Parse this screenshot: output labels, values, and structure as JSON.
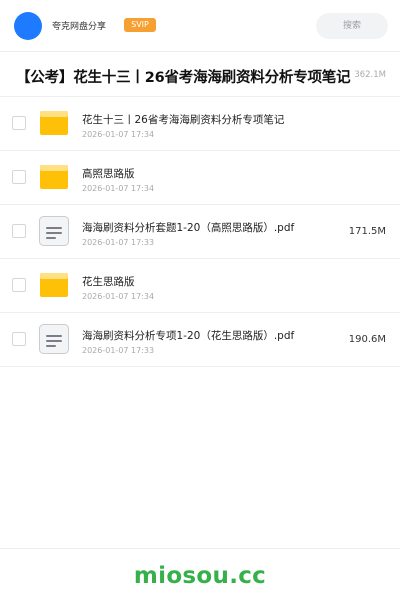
{
  "header": {
    "share_name": "夸克网盘分享",
    "badge": "SVIP",
    "search_label": "搜索"
  },
  "folder": {
    "title": "【公考】花生十三丨26省考海海刷资料分析专项笔记",
    "size": "362.1M"
  },
  "files": [
    {
      "type": "folder",
      "icon": "folder-icon",
      "name": "花生十三丨26省考海海刷资料分析专项笔记",
      "date": "2026-01-07 17:34",
      "size": ""
    },
    {
      "type": "folder",
      "icon": "folder-icon",
      "name": "高照思路版",
      "date": "2026-01-07 17:34",
      "size": ""
    },
    {
      "type": "file",
      "icon": "document-icon",
      "name": "海海刷资料分析套题1-20（高照思路版）.pdf",
      "date": "2026-01-07 17:33",
      "size": "171.5M"
    },
    {
      "type": "folder",
      "icon": "folder-icon",
      "name": "花生思路版",
      "date": "2026-01-07 17:34",
      "size": ""
    },
    {
      "type": "file",
      "icon": "document-icon",
      "name": "海海刷资料分析专项1-20（花生思路版）.pdf",
      "date": "2026-01-07 17:33",
      "size": "190.6M"
    }
  ],
  "footer": {
    "watermark": "miosou.cc"
  },
  "colors": {
    "avatar": "#1e7bff",
    "badge": "#f7a032",
    "folder": "#ffc107",
    "watermark": "#35b04b"
  }
}
